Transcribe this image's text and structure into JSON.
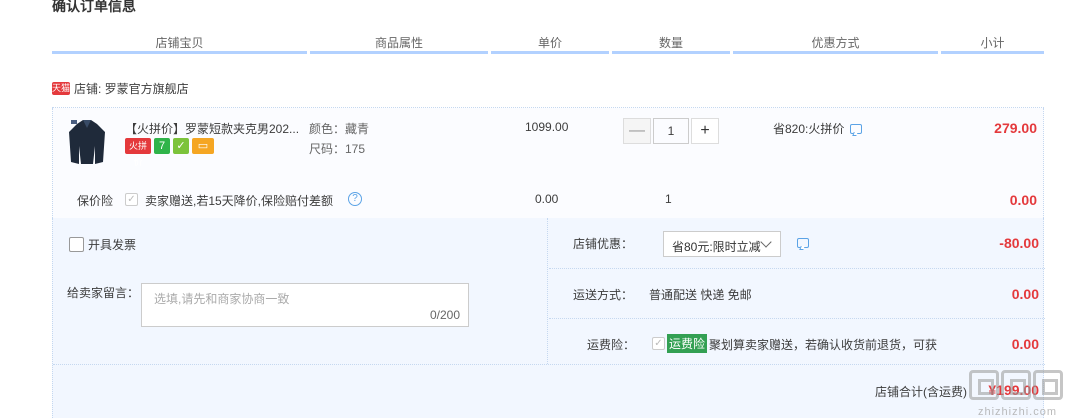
{
  "section_title": "确认订单信息",
  "headers": [
    "店铺宝贝",
    "商品属性",
    "单价",
    "数量",
    "优惠方式",
    "小计"
  ],
  "shop": {
    "icon_text": "天猫",
    "label": "店铺: 罗蒙官方旗舰店"
  },
  "item": {
    "title": "【火拼价】罗蒙短款夹克男202...",
    "badges": [
      {
        "text": "火拼价",
        "color": "#e4393c"
      },
      {
        "text": "7",
        "color": "#2fb44a"
      },
      {
        "text": "✓",
        "color": "#7cc33b"
      },
      {
        "text": "▭",
        "color": "#f5a623"
      }
    ],
    "color_attr": "颜色：藏青",
    "size_attr": "尺码：175",
    "unit_price": "1099.00",
    "qty_minus": "—",
    "qty": "1",
    "qty_plus": "+",
    "promo": "省820:火拼价",
    "subtotal": "279.00"
  },
  "insurance": {
    "label": "保价险",
    "check": "✓",
    "text": "卖家赠送,若15天降价,保险赔付差额",
    "help": "?",
    "price": "0.00",
    "qty": "1",
    "subtotal": "0.00"
  },
  "invoice": {
    "label": "开具发票"
  },
  "message": {
    "label": "给卖家留言：",
    "placeholder": "选填,请先和商家协商一致",
    "count": "0/200"
  },
  "shop_discount": {
    "label": "店铺优惠：",
    "selected": "省80元:限时立减",
    "amount": "-80.00"
  },
  "shipping": {
    "label": "运送方式：",
    "value": "普通配送 快递 免邮",
    "amount": "0.00"
  },
  "freight_insurance": {
    "label": "运费险：",
    "check": "✓",
    "tag": "运费险",
    "text": "聚划算卖家赠送，若确认收货前退货，可获",
    "amount": "0.00"
  },
  "total": {
    "label": "店铺合计(含运费)",
    "value": "¥199.00"
  },
  "watermark": "zhizhizhi.com",
  "colors": {
    "header_underline": "#b2d1ff",
    "price_red": "#e4393c",
    "panel_bg": "#f2f7ff",
    "freight_tag": "#33a053"
  }
}
